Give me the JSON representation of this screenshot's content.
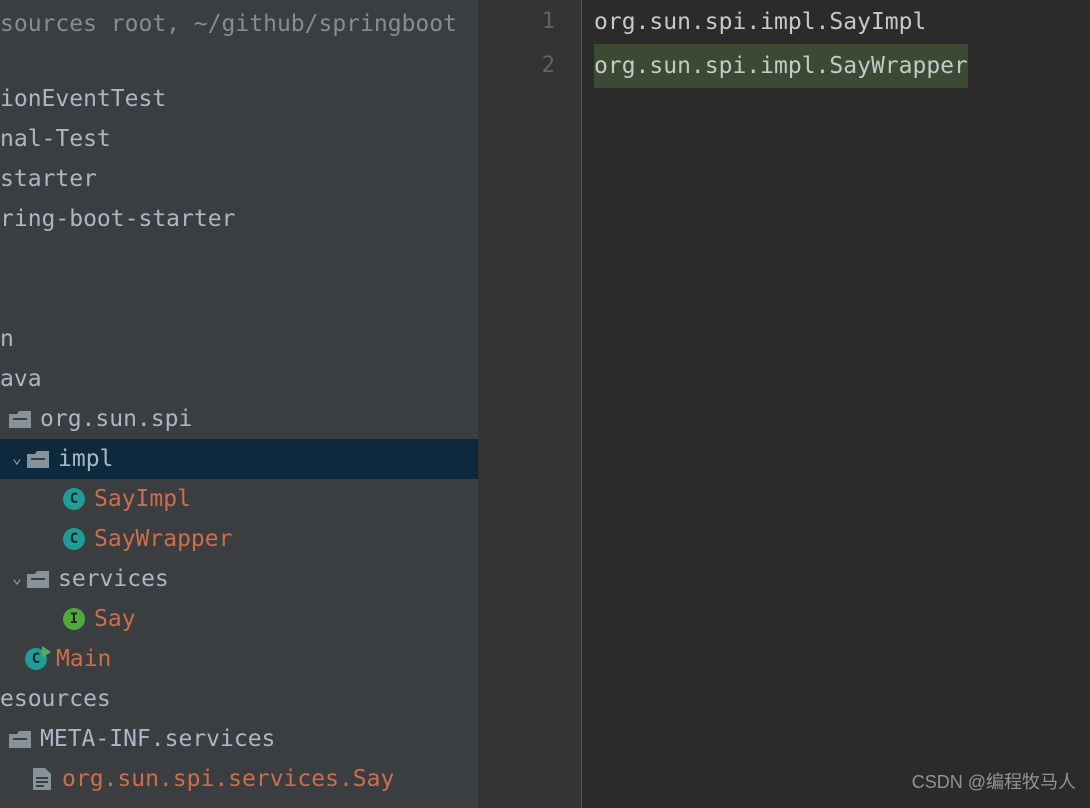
{
  "breadcrumb": " sources root, ~/github/springboot",
  "tree": {
    "items": [
      {
        "indent": 0,
        "type": "text",
        "label": "ionEventTest"
      },
      {
        "indent": 0,
        "type": "text",
        "label": "nal-Test"
      },
      {
        "indent": 0,
        "type": "text",
        "label": "starter"
      },
      {
        "indent": 0,
        "type": "text",
        "label": "ring-boot-starter"
      },
      {
        "indent": 0,
        "type": "gap"
      },
      {
        "indent": 0,
        "type": "gap"
      },
      {
        "indent": 0,
        "type": "text",
        "label": "n"
      },
      {
        "indent": 0,
        "type": "text",
        "label": "ava"
      },
      {
        "indent": 8,
        "type": "package",
        "label": "org.sun.spi",
        "orange": false
      },
      {
        "indent": 8,
        "type": "package",
        "label": "impl",
        "orange": false,
        "expander": true,
        "selected": true
      },
      {
        "indent": 62,
        "type": "class",
        "label": "SayImpl",
        "orange": true
      },
      {
        "indent": 62,
        "type": "class",
        "label": "SayWrapper",
        "orange": true
      },
      {
        "indent": 8,
        "type": "package",
        "label": "services",
        "orange": false,
        "expander": true
      },
      {
        "indent": 62,
        "type": "interface",
        "label": "Say",
        "orange": true
      },
      {
        "indent": 24,
        "type": "classrun",
        "label": "Main",
        "orange": true
      },
      {
        "indent": 0,
        "type": "text",
        "label": "esources"
      },
      {
        "indent": 8,
        "type": "package",
        "label": "META-INF.services",
        "orange": false
      },
      {
        "indent": 30,
        "type": "file",
        "label": "org.sun.spi.services.Say",
        "orange": true
      }
    ]
  },
  "gutter": {
    "lines": [
      "1",
      "2"
    ]
  },
  "editor": {
    "lines": [
      {
        "text": "org.sun.spi.impl.SayImpl",
        "hl": false
      },
      {
        "text": "org.sun.spi.impl.SayWrapper",
        "hl": true
      }
    ]
  },
  "watermark": "CSDN @编程牧马人",
  "icons": {
    "classLetter": "C",
    "ifaceLetter": "I"
  }
}
